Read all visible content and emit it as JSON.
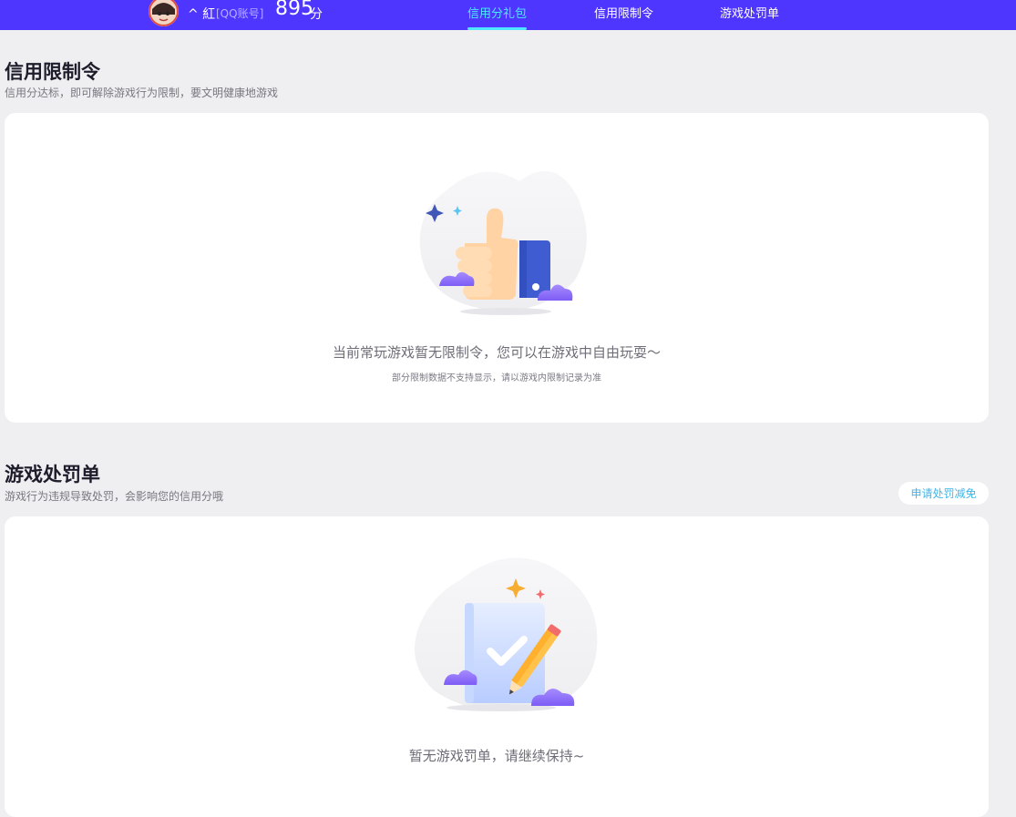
{
  "header": {
    "username": "^ 紅",
    "account_type": "[QQ账号]",
    "score": "895",
    "score_unit": "分",
    "tabs": [
      {
        "label": "信用分礼包",
        "active": true
      },
      {
        "label": "信用限制令",
        "active": false
      },
      {
        "label": "游戏处罚单",
        "active": false
      }
    ],
    "colors": {
      "bar": "#4e36ff",
      "active_tab": "#4fe7ff"
    }
  },
  "restriction": {
    "title": "信用限制令",
    "desc": "信用分达标，即可解除游戏行为限制，要文明健康地游戏",
    "empty_main": "当前常玩游戏暂无限制令，您可以在游戏中自由玩耍～",
    "empty_sub": "部分限制数据不支持显示，请以游戏内限制记录为准",
    "illustration": "thumbs-up-icon"
  },
  "penalty": {
    "title": "游戏处罚单",
    "desc": "游戏行为违规导致处罚，会影响您的信用分哦",
    "appeal_button": "申请处罚减免",
    "empty_main": "暂无游戏罚单，请继续保持~",
    "illustration": "clipboard-check-icon"
  }
}
